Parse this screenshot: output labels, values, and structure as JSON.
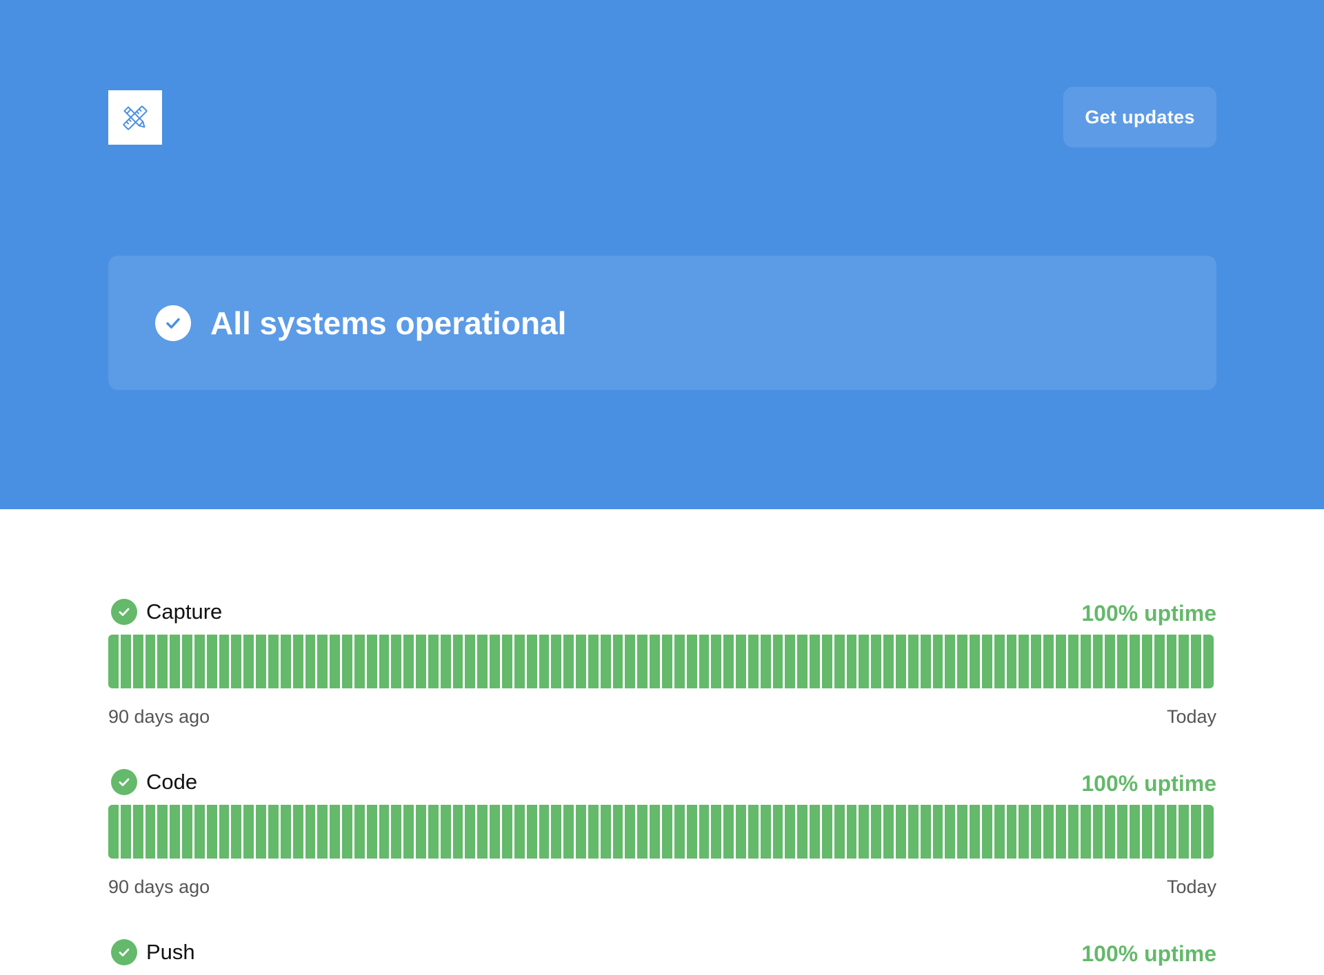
{
  "header": {
    "logo_icon": "pencil-ruler-icon",
    "get_updates_label": "Get updates",
    "accent_color": "#4a90e2"
  },
  "status": {
    "icon": "check-circle-icon",
    "message": "All systems operational"
  },
  "components": [
    {
      "name": "Capture",
      "uptime": "100% uptime",
      "range_start": "90 days ago",
      "range_end": "Today",
      "status_color": "#64b96a",
      "days_shown": 90,
      "days_operational": 90
    },
    {
      "name": "Code",
      "uptime": "100% uptime",
      "range_start": "90 days ago",
      "range_end": "Today",
      "status_color": "#64b96a",
      "days_shown": 90,
      "days_operational": 90
    },
    {
      "name": "Push",
      "uptime": "100% uptime",
      "status_color": "#64b96a"
    }
  ]
}
